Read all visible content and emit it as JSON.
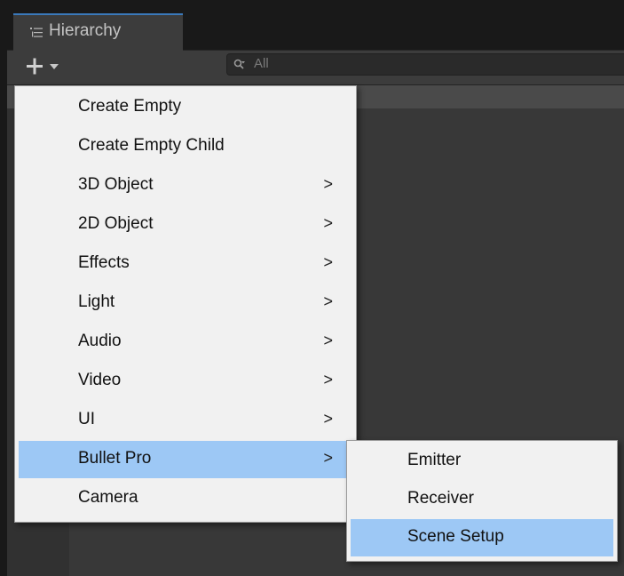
{
  "hierarchy": {
    "tab_title": "Hierarchy",
    "add_icon": "plus-icon",
    "search_placeholder": "All",
    "tab_icon": "list-icon"
  },
  "create_menu": {
    "items": [
      {
        "label": "Create Empty",
        "has_submenu": false
      },
      {
        "label": "Create Empty Child",
        "has_submenu": false
      },
      {
        "label": "3D Object",
        "has_submenu": true
      },
      {
        "label": "2D Object",
        "has_submenu": true
      },
      {
        "label": "Effects",
        "has_submenu": true
      },
      {
        "label": "Light",
        "has_submenu": true
      },
      {
        "label": "Audio",
        "has_submenu": true
      },
      {
        "label": "Video",
        "has_submenu": true
      },
      {
        "label": "UI",
        "has_submenu": true
      },
      {
        "label": "Bullet Pro",
        "has_submenu": true,
        "highlighted": true
      },
      {
        "label": "Camera",
        "has_submenu": false
      }
    ],
    "submenu_arrow": ">"
  },
  "bullet_pro_submenu": {
    "items": [
      {
        "label": "Emitter"
      },
      {
        "label": "Receiver"
      },
      {
        "label": "Scene Setup",
        "highlighted": true
      }
    ]
  },
  "colors": {
    "highlight": "#9dc8f5",
    "tab_accent": "#3a79bb",
    "menu_bg": "#f1f1f1"
  }
}
